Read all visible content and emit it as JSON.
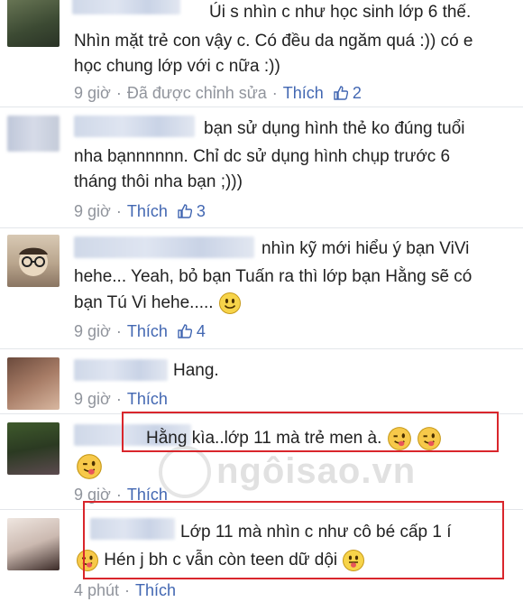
{
  "comments": [
    {
      "lines": [
        "Úi s nhìn c như học sinh lớp 6 thế.",
        "Nhìn mặt trẻ con vậy c. Có đều da ngăm quá :)) có e",
        "học chung lớp với c nữa :))"
      ],
      "time": "9 giờ",
      "edited": "Đã được chỉnh sửa",
      "like_label": "Thích",
      "likes": "2"
    },
    {
      "lines": [
        "bạn sử dụng hình thẻ ko đúng tuổi",
        "nha bạnnnnnn. Chỉ dc sử dụng hình chụp trước 6",
        "tháng thôi nha bạn ;)))"
      ],
      "time": "9 giờ",
      "like_label": "Thích",
      "likes": "3"
    },
    {
      "lines": [
        "nhìn kỹ mới hiểu ý bạn ViVi",
        "hehe... Yeah, bỏ bạn Tuấn ra thì lớp bạn Hằng sẽ có",
        "bạn Tú Vi hehe....."
      ],
      "time": "9 giờ",
      "like_label": "Thích",
      "likes": "4"
    },
    {
      "lines": [
        "Hang."
      ],
      "time": "9 giờ",
      "like_label": "Thích"
    },
    {
      "lines": [
        "Hằng kìa..lớp 11 mà trẻ men à."
      ],
      "time": "9 giờ",
      "like_label": "Thích"
    },
    {
      "lines": [
        "Lớp 11 mà nhìn c như cô bé cấp 1 í",
        "Hén j bh c vẫn còn teen dữ dội"
      ],
      "time": "4 phút",
      "like_label": "Thích"
    }
  ],
  "watermark": "ngôisao.vn",
  "colors": {
    "link": "#4267b2",
    "meta": "#90949c",
    "highlight": "#d9262c"
  },
  "icons": [
    "thumbs-up-icon",
    "smile-emoji-icon",
    "wink-tongue-emoji-icon",
    "tongue-emoji-icon"
  ]
}
